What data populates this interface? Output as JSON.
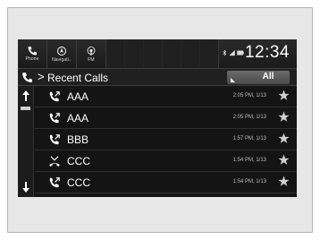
{
  "topbar": {
    "apps": [
      {
        "label": "Phone",
        "icon": "phone-icon"
      },
      {
        "label": "Navigati..",
        "icon": "navigation-icon"
      },
      {
        "label": "FM",
        "icon": "radio-icon"
      }
    ],
    "clock": "12:34",
    "status_icons": [
      "bluetooth-icon",
      "signal-icon",
      "battery-icon"
    ]
  },
  "header": {
    "title": "Recent Calls",
    "filter_label": "All"
  },
  "calls": [
    {
      "name": "AAA",
      "time": "2:05 PM, 1/13",
      "type": "outgoing",
      "icon": "outgoing-call-icon"
    },
    {
      "name": "AAA",
      "time": "2:05 PM, 1/13",
      "type": "outgoing",
      "icon": "outgoing-call-icon"
    },
    {
      "name": "BBB",
      "time": "1:57 PM, 1/13",
      "type": "outgoing",
      "icon": "outgoing-call-icon"
    },
    {
      "name": "CCC",
      "time": "1:54 PM, 1/13",
      "type": "missed",
      "icon": "missed-call-icon"
    },
    {
      "name": "CCC",
      "time": "1:54 PM, 1/13",
      "type": "outgoing",
      "icon": "outgoing-call-icon"
    }
  ],
  "colors": {
    "screen_bg": "#141414",
    "text": "#ffffff",
    "star": "#cfcfcf",
    "muted_text": "#bdbdbd"
  }
}
